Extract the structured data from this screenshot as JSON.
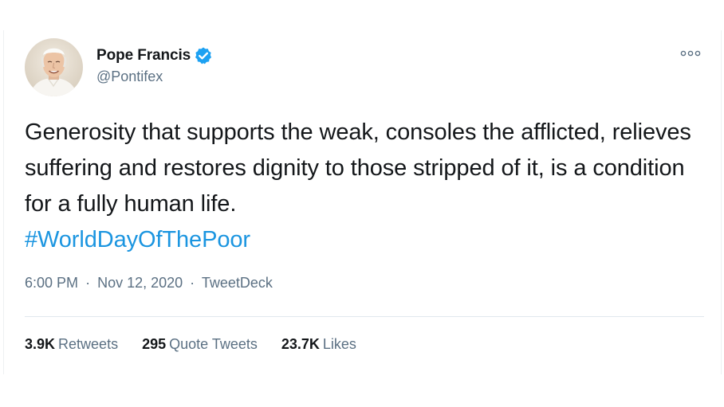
{
  "author": {
    "name": "Pope Francis",
    "handle": "@Pontifex",
    "verified": true,
    "avatar_icon": "pope-portrait-avatar"
  },
  "tweet": {
    "text": "Generosity that supports the weak, consoles the afflicted, relieves suffering and restores dignity to those stripped of it, is a condition for a fully human life.",
    "hashtag": "#WorldDayOfThePoor"
  },
  "meta": {
    "time": "6:00 PM",
    "separator": "·",
    "date": "Nov 12, 2020",
    "source": "TweetDeck"
  },
  "stats": {
    "retweets": {
      "count": "3.9K",
      "label": "Retweets"
    },
    "quotes": {
      "count": "295",
      "label": "Quote Tweets"
    },
    "likes": {
      "count": "23.7K",
      "label": "Likes"
    }
  },
  "colors": {
    "link": "#1b95e0",
    "verified": "#1da1f2",
    "secondary_text": "#5b7083",
    "primary_text": "#14171a"
  },
  "icons": {
    "verified": "verified-badge-icon",
    "more": "more-options-icon"
  }
}
